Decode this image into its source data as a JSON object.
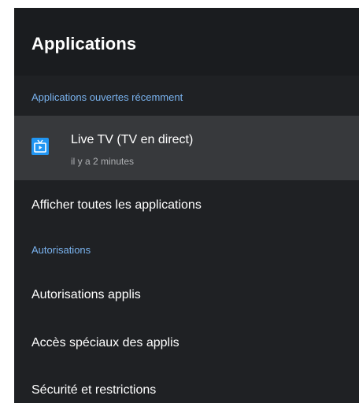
{
  "header": {
    "title": "Applications"
  },
  "recent": {
    "section_label": "Applications ouvertes récemment",
    "apps": [
      {
        "name": "Live TV (TV en direct)",
        "subtitle": "il y a 2 minutes",
        "icon": "tv-icon",
        "icon_color": "#2196f3"
      }
    ]
  },
  "menu": {
    "show_all": "Afficher toutes les applications"
  },
  "permissions": {
    "section_label": "Autorisations",
    "items": [
      "Autorisations applis",
      "Accès spéciaux des applis",
      "Sécurité et restrictions"
    ]
  },
  "colors": {
    "background": "#1f2124",
    "header_bg": "#1a1c1f",
    "selected_row": "#37393c",
    "accent": "#7ab3ef"
  }
}
